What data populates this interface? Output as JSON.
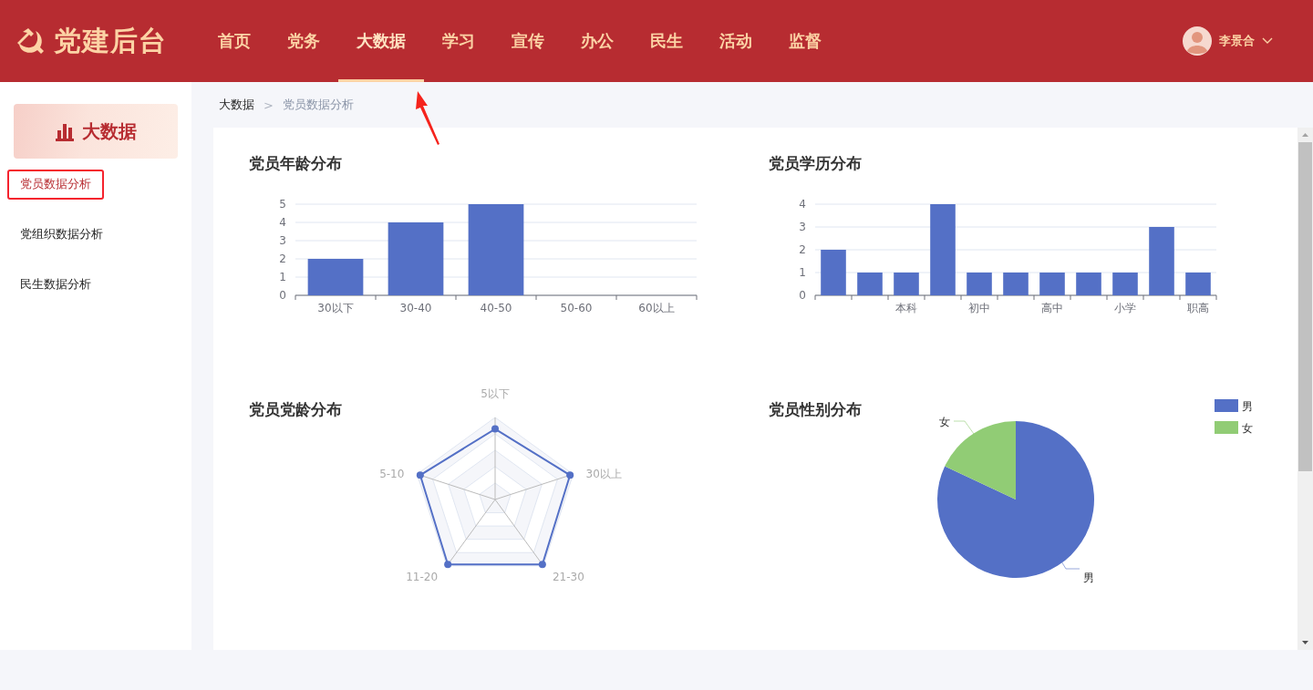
{
  "header": {
    "logo_text": "党建后台",
    "nav": [
      {
        "label": "首页",
        "selected": false
      },
      {
        "label": "党务",
        "selected": false
      },
      {
        "label": "大数据",
        "selected": true
      },
      {
        "label": "学习",
        "selected": false
      },
      {
        "label": "宣传",
        "selected": false
      },
      {
        "label": "办公",
        "selected": false
      },
      {
        "label": "民生",
        "selected": false
      },
      {
        "label": "活动",
        "selected": false
      },
      {
        "label": "监督",
        "selected": false
      }
    ],
    "user": {
      "name": "李景合"
    }
  },
  "sidebar": {
    "banner": "大数据",
    "items": [
      {
        "label": "党员数据分析",
        "selected": true
      },
      {
        "label": "党组织数据分析",
        "selected": false
      },
      {
        "label": "民生数据分析",
        "selected": false
      }
    ]
  },
  "breadcrumb": {
    "items": [
      "大数据",
      "党员数据分析"
    ],
    "separator": ">"
  },
  "panels": [
    {
      "kind": "bar",
      "title": "党员年龄分布",
      "chart_data": {
        "type": "bar",
        "categories": [
          "30以下",
          "30-40",
          "40-50",
          "50-60",
          "60以上"
        ],
        "series": [
          {
            "color": "#5470c6",
            "values": [
              2,
              4,
              5,
              0,
              0
            ]
          }
        ],
        "yticks": [
          0,
          1,
          2,
          3,
          4,
          5
        ],
        "ylim": [
          0,
          5
        ],
        "grid": true
      }
    },
    {
      "kind": "bar",
      "title": "党员学历分布",
      "chart_data": {
        "type": "bar",
        "categories": [
          null,
          null,
          "本科",
          null,
          "初中",
          null,
          "高中",
          null,
          "小学",
          null,
          "职高"
        ],
        "series": [
          {
            "color": "#5470c6",
            "values": [
              2,
              1,
              1,
              4,
              1,
              1,
              1,
              1,
              1,
              3,
              1
            ]
          }
        ],
        "yticks": [
          0,
          1,
          2,
          3,
          4
        ],
        "ylim": [
          0,
          4
        ],
        "grid": true
      }
    },
    {
      "kind": "radar",
      "title": "党员党龄分布",
      "axes": [
        "5以下",
        "30以上",
        "21-30",
        "11-20",
        "5-10"
      ],
      "color": "#5470c6"
    },
    {
      "kind": "pie",
      "title": "党员性别分布",
      "legend": [
        {
          "label": "男",
          "color": "#5470c6"
        },
        {
          "label": "女",
          "color": "#91cc75"
        }
      ],
      "slice_labels": [
        "男",
        "女"
      ]
    }
  ]
}
